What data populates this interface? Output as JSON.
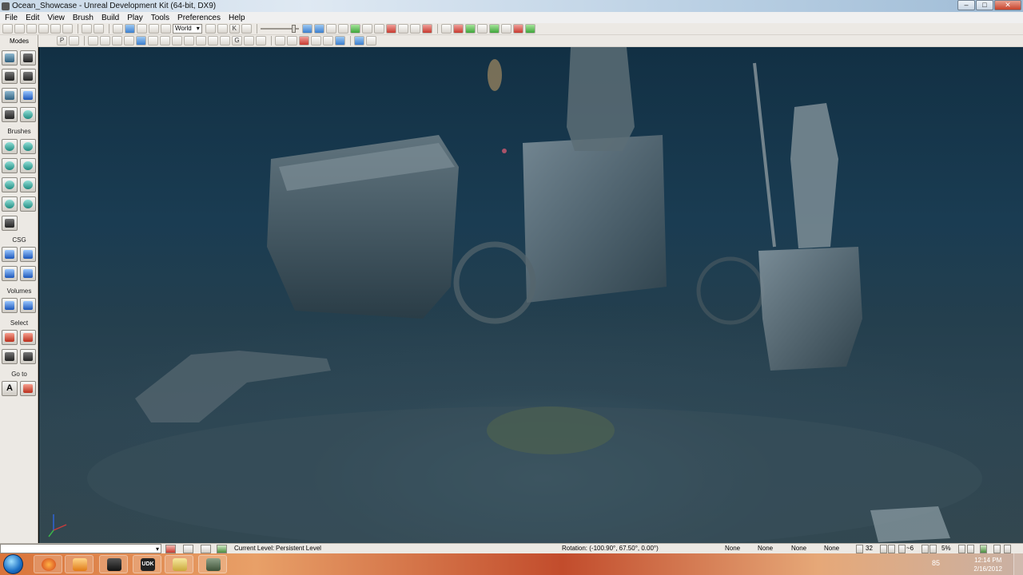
{
  "window": {
    "title": "Ocean_Showcase - Unreal Development Kit (64-bit, DX9)",
    "minimize_glyph": "–",
    "maximize_glyph": "□",
    "close_glyph": "✕"
  },
  "menu": {
    "items": [
      "File",
      "Edit",
      "View",
      "Brush",
      "Build",
      "Play",
      "Tools",
      "Preferences",
      "Help"
    ]
  },
  "toolbar": {
    "coord_system": "World",
    "kismet_label": "K",
    "grid_label": "G",
    "p_label": "P"
  },
  "modes_panel": {
    "header": "Modes",
    "sections": {
      "brushes": "Brushes",
      "csg": "CSG",
      "volumes": "Volumes",
      "select": "Select",
      "goto": "Go to"
    },
    "goto_actor_label": "A"
  },
  "statusbar": {
    "current_level_label": "Current Level:",
    "current_level_value": "Persistent Level",
    "rotation": "Rotation: (-100.90°, 67.50°, 0.00°)",
    "slots": [
      "None",
      "None",
      "None",
      "None"
    ],
    "grid_size": "32",
    "rotation_snap": "~6",
    "scale_snap": "5%"
  },
  "taskbar": {
    "tray_value": "85",
    "time": "12:14 PM",
    "date": "2/16/2012",
    "udk_label": "UDK"
  },
  "colors": {
    "water_deep": "#123044",
    "seabed": "#33474f",
    "taskbar_accent": "#d9743a"
  }
}
